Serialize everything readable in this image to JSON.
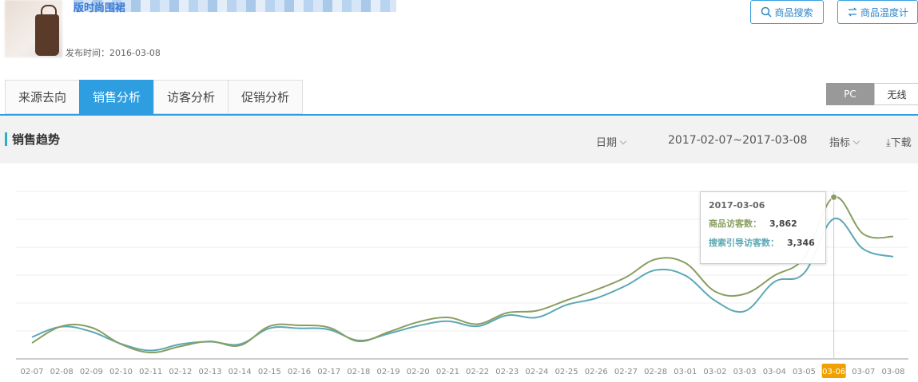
{
  "product": {
    "title": "版时尚围裙",
    "publish_label": "发布时间：",
    "publish_date": "2016-03-08"
  },
  "toolbar": {
    "search_label": "商品搜索",
    "temp_label": "商品温度计"
  },
  "tabs": [
    {
      "label": "来源去向"
    },
    {
      "label": "销售分析"
    },
    {
      "label": "访客分析"
    },
    {
      "label": "促销分析"
    }
  ],
  "device_toggle": {
    "pc": "PC",
    "wireless": "无线"
  },
  "section": {
    "title": "销售趋势",
    "date_label": "日期",
    "date_range": "2017-02-07~2017-03-08",
    "metric_label": "指标",
    "download_label": "下载"
  },
  "tooltip": {
    "date": "2017-03-06",
    "rows": [
      {
        "name": "商品访客数：",
        "value": "3,862"
      },
      {
        "name": "搜索引导访客数：",
        "value": "3,346"
      }
    ]
  },
  "chart_data": {
    "type": "line",
    "x": [
      "02-07",
      "02-08",
      "02-09",
      "02-10",
      "02-11",
      "02-12",
      "02-13",
      "02-14",
      "02-15",
      "02-16",
      "02-17",
      "02-18",
      "02-19",
      "02-20",
      "02-21",
      "02-22",
      "02-23",
      "02-24",
      "02-25",
      "02-26",
      "02-27",
      "02-28",
      "03-01",
      "03-02",
      "03-03",
      "03-04",
      "03-05",
      "03-06",
      "03-07",
      "03-08"
    ],
    "highlight": "03-06",
    "ylim": [
      0,
      4000
    ],
    "grid": true,
    "series": [
      {
        "name": "商品访客数",
        "color": "#8a9e62",
        "values": [
          380,
          780,
          750,
          350,
          150,
          300,
          420,
          320,
          780,
          800,
          750,
          420,
          640,
          880,
          990,
          830,
          1100,
          1150,
          1400,
          1650,
          1950,
          2380,
          2290,
          1610,
          1550,
          1990,
          2420,
          3862,
          2980,
          2920
        ]
      },
      {
        "name": "搜索引导访客数",
        "color": "#5ba8b4",
        "values": [
          520,
          770,
          650,
          360,
          200,
          350,
          410,
          350,
          730,
          730,
          700,
          440,
          600,
          790,
          900,
          780,
          1040,
          990,
          1290,
          1450,
          1750,
          2120,
          1990,
          1390,
          1140,
          1840,
          2050,
          3346,
          2620,
          2440
        ]
      }
    ]
  }
}
